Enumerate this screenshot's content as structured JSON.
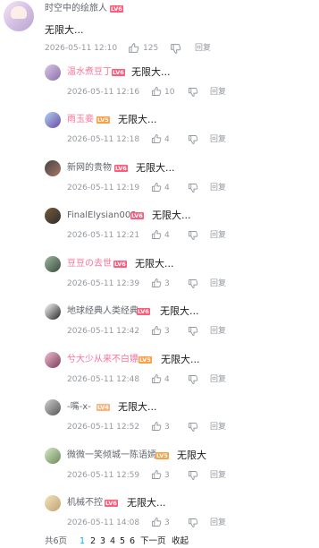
{
  "root": {
    "username": "时空中的绘旅人",
    "level": "LV6",
    "content": "无限大...",
    "time": "2026-05-11 12:10",
    "likes": "125",
    "reply_label": "回复"
  },
  "replies": [
    {
      "username": "温水煮豆丁",
      "level": "LV6",
      "content": "无限大...",
      "time": "2026-05-11 12:16",
      "likes": "10",
      "reply_label": "回复"
    },
    {
      "username": "雨玉妾",
      "level": "LV5",
      "content": "无限大...",
      "time": "2026-05-11 12:18",
      "likes": "4",
      "reply_label": "回复"
    },
    {
      "username": "新网的贵物",
      "level": "LV6",
      "content": "无限大...",
      "time": "2026-05-11 12:19",
      "likes": "4",
      "reply_label": "回复"
    },
    {
      "username": "FinalElysian003",
      "level": "LV6",
      "content": "无限大...",
      "time": "2026-05-11 12:21",
      "likes": "4",
      "reply_label": "回复"
    },
    {
      "username": "豆豆の去世",
      "level": "LV6",
      "content": "无限大...",
      "time": "2026-05-11 12:39",
      "likes": "3",
      "reply_label": "回复"
    },
    {
      "username": "地球经典人类经典",
      "level": "LV6",
      "content": "无限大...",
      "time": "2026-05-11 12:42",
      "likes": "3",
      "reply_label": "回复"
    },
    {
      "username": "兮大少从来不白嫖",
      "level": "LV5",
      "content": "无限大...",
      "time": "2026-05-11 12:48",
      "likes": "4",
      "reply_label": "回复"
    },
    {
      "username": "-嘴-x-",
      "level": "LV4",
      "content": "无限大...",
      "time": "2026-05-11 12:52",
      "likes": "3",
      "reply_label": "回复"
    },
    {
      "username": "微微一笑倾城一陈语嫣",
      "level": "LV5",
      "content": "无限大",
      "time": "2026-05-11 12:59",
      "likes": "3",
      "reply_label": "回复"
    },
    {
      "username": "机械不控",
      "level": "LV6",
      "content": "无限大...",
      "time": "2026-05-11 14:08",
      "likes": "3",
      "reply_label": "回复"
    }
  ],
  "pager": {
    "total": "共6页",
    "pages": [
      "1",
      "2",
      "3",
      "4",
      "5",
      "6"
    ],
    "current": "1",
    "next_label": "下一页",
    "collapse_label": "收起"
  },
  "colors": {
    "pink_name": "#fb7299",
    "gray_name": "#61666d",
    "meta": "#9499a0",
    "current_page": "#00aeec",
    "level_6": "#ff5c7c",
    "level_5": "#ff9f43"
  },
  "icons": {
    "like": "thumb-up-icon",
    "dislike": "thumb-down-icon"
  }
}
